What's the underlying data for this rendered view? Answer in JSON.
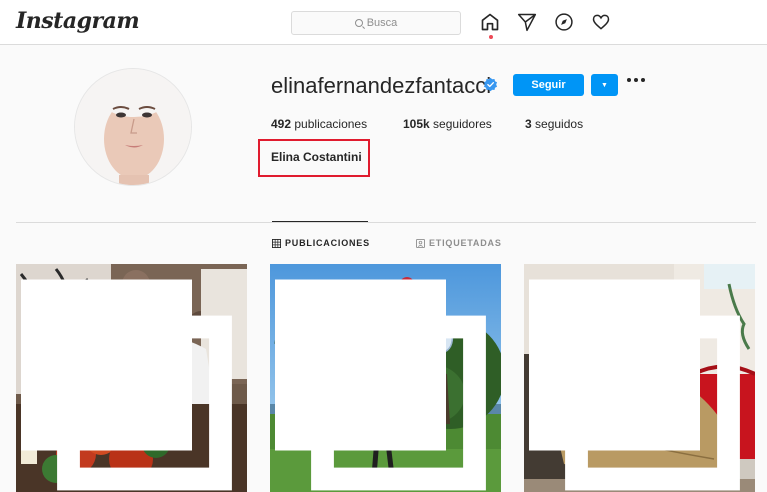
{
  "header": {
    "logo": "Instagram",
    "search_placeholder": "Busca",
    "nav_icons": [
      "home-icon",
      "direct-icon",
      "explore-icon",
      "activity-icon"
    ]
  },
  "profile": {
    "username": "elinafernandezfantacci",
    "verified": true,
    "follow_label": "Seguir",
    "stats": {
      "posts_count": "492",
      "posts_label": "publicaciones",
      "followers_count": "105k",
      "followers_label": "seguidores",
      "following_count": "3",
      "following_label": "seguidos"
    },
    "full_name": "Elina Costantini"
  },
  "tabs": [
    {
      "label": "PUBLICACIONES",
      "active": true
    },
    {
      "label": "ETIQUETADAS",
      "active": false
    }
  ],
  "posts": [
    {
      "subject": "couple-dinner-photo"
    },
    {
      "subject": "park-balloons-photo"
    },
    {
      "subject": "gold-dress-photo"
    }
  ],
  "colors": {
    "accent": "#0095f6",
    "highlight_box": "#e01b2e",
    "notification_dot": "#ed4956"
  }
}
